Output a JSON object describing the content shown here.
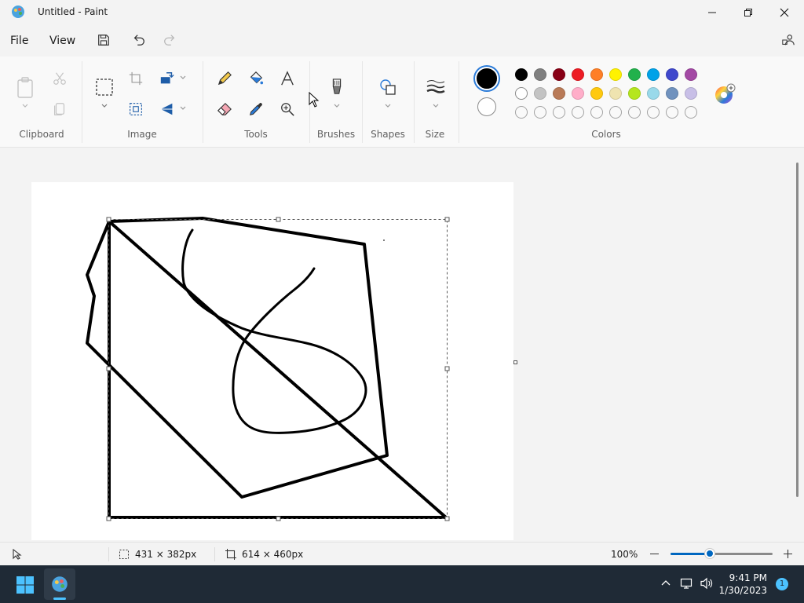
{
  "window": {
    "title": "Untitled - Paint"
  },
  "menu": {
    "file": "File",
    "view": "View"
  },
  "ribbon": {
    "groups": {
      "clipboard": "Clipboard",
      "image": "Image",
      "tools": "Tools",
      "brushes": "Brushes",
      "shapes": "Shapes",
      "size": "Size",
      "colors": "Colors"
    },
    "primary_color": "#000000",
    "secondary_color": "#ffffff",
    "palette_row1": [
      "#000000",
      "#7f7f7f",
      "#880015",
      "#ed1c24",
      "#ff7f27",
      "#fff200",
      "#22b14c",
      "#00a2e8",
      "#3f48cc",
      "#a349a4"
    ],
    "palette_row2": [
      "#ffffff",
      "#c3c3c3",
      "#b97a57",
      "#ffaec9",
      "#ffc90e",
      "#efe4b0",
      "#b5e61d",
      "#99d9ea",
      "#7092be",
      "#c8bfe7"
    ]
  },
  "status": {
    "selection_size": "431 × 382px",
    "canvas_size": "614 × 460px",
    "zoom": "100%"
  },
  "taskbar": {
    "time": "9:41 PM",
    "date": "1/30/2023",
    "notifications": "1"
  }
}
